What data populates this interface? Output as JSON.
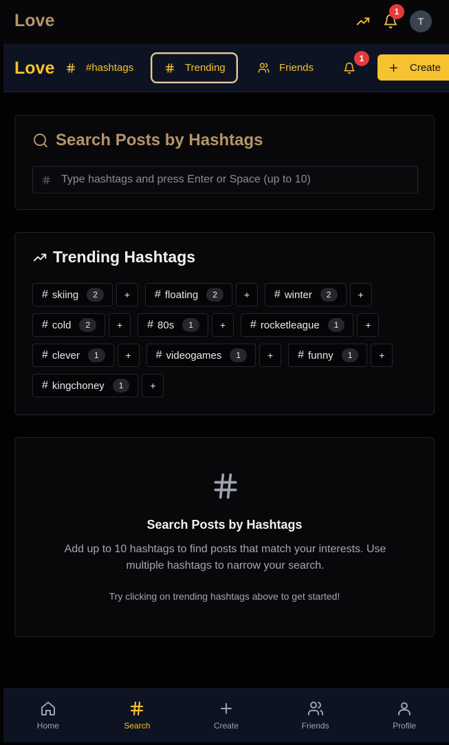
{
  "topbar": {
    "brand": "Love",
    "notification_count": "1",
    "avatar_initial": "T"
  },
  "navbar": {
    "brand": "Love",
    "items": [
      {
        "label": "#hashtags"
      },
      {
        "label": "Trending"
      },
      {
        "label": "Friends"
      }
    ],
    "notification_count": "1",
    "create_label": "Create"
  },
  "search": {
    "title": "Search Posts by Hashtags",
    "placeholder": "Type hashtags and press Enter or Space (up to 10)"
  },
  "trending": {
    "title": "Trending Hashtags",
    "tags": [
      {
        "name": "skiing",
        "count": "2"
      },
      {
        "name": "floating",
        "count": "2"
      },
      {
        "name": "winter",
        "count": "2"
      },
      {
        "name": "cold",
        "count": "2"
      },
      {
        "name": "80s",
        "count": "1"
      },
      {
        "name": "rocketleague",
        "count": "1"
      },
      {
        "name": "clever",
        "count": "1"
      },
      {
        "name": "videogames",
        "count": "1"
      },
      {
        "name": "funny",
        "count": "1"
      },
      {
        "name": "kingchoney",
        "count": "1"
      }
    ],
    "add_label": "+"
  },
  "empty": {
    "title": "Search Posts by Hashtags",
    "description": "Add up to 10 hashtags to find posts that match your interests. Use multiple hashtags to narrow your search.",
    "hint": "Try clicking on trending hashtags above to get started!"
  },
  "bottomnav": {
    "items": [
      {
        "label": "Home"
      },
      {
        "label": "Search"
      },
      {
        "label": "Create"
      },
      {
        "label": "Friends"
      },
      {
        "label": "Profile"
      }
    ]
  },
  "colors": {
    "accent": "#f6c230",
    "muted_brand": "#b5946b",
    "badge": "#e53a3a",
    "background": "#020203"
  }
}
